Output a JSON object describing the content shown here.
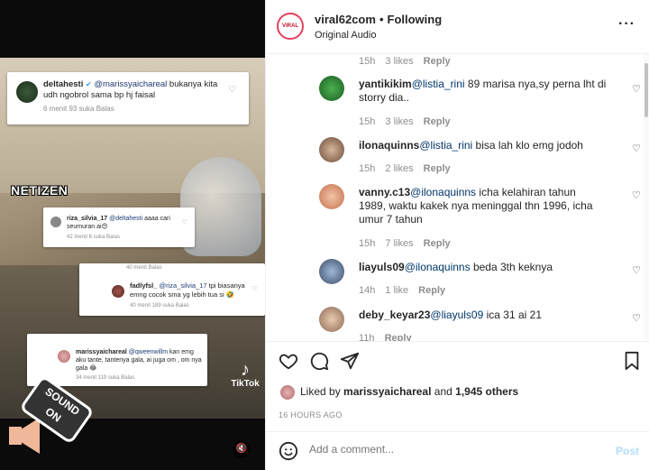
{
  "video": {
    "c1": {
      "user": "deltahesti",
      "mention": "@marissyaichareal",
      "text": " bukanya kita udh ngobrol sama bp hj faisal",
      "meta": "6 menit     93 suka     Balas"
    },
    "netizen": "NETIZEN",
    "c2": {
      "user": "riza_silvia_17",
      "mention": "@deltahesti",
      "text": " aaaa cari seumuran ai😍",
      "meta": "42 menit     6 suka     Balas"
    },
    "c3": {
      "top": "40 menit     Balas",
      "user": "fadlyfsl_",
      "mention": "@riza_silvia_17",
      "text": " tpi biasanya emng cocok sma yg lebih tua si 🤣",
      "meta": "40 menit     189 suka     Balas"
    },
    "c4": {
      "user": "marissyaichareal",
      "mention": "@qweenwillm",
      "text": " kan emg aku tante, tantenya gala, ai juga om , om nya gala 😂",
      "meta": "34 menit     119 suka     Balas"
    },
    "tiktok": "TikTok",
    "sound_badge": "SOUND ON",
    "mute_icon": "🔇"
  },
  "header": {
    "logo_text": "VIRAL",
    "username": "viral62com",
    "dot": "•",
    "follow": "Following",
    "audio": "Original Audio",
    "more": "···"
  },
  "comments": [
    {
      "meta_top": {
        "time": "15h",
        "likes": "3 likes",
        "reply": "Reply"
      }
    },
    {
      "user": "yantikikim",
      "mention": "@listia_rini",
      "text": " 89 marisa nya,sy perna lht di storry dia..",
      "time": "15h",
      "likes": "3 likes",
      "reply": "Reply"
    },
    {
      "user": "ilonaquinns",
      "mention": "@listia_rini",
      "text": " bisa lah klo emg jodoh",
      "time": "15h",
      "likes": "2 likes",
      "reply": "Reply"
    },
    {
      "user": "vanny.c13",
      "mention": "@ilonaquinns",
      "text": " icha kelahiran tahun 1989, waktu kakek nya meninggal thn 1996, icha umur 7 tahun",
      "time": "15h",
      "likes": "7 likes",
      "reply": "Reply"
    },
    {
      "user": "liayuls09",
      "mention": "@ilonaquinns",
      "text": " beda 3th keknya",
      "time": "14h",
      "likes": "1 like",
      "reply": "Reply"
    },
    {
      "user": "deby_keyar23",
      "mention": "@liayuls09",
      "text": " ica 31 ai 21",
      "time": "11h",
      "likes": "",
      "reply": "Reply"
    }
  ],
  "actions": {
    "liked_prefix": "Liked by ",
    "liked_user": "marissyaichareal",
    "liked_and": " and ",
    "liked_others": "1,945 others",
    "time": "16 HOURS AGO"
  },
  "addbar": {
    "placeholder": "Add a comment...",
    "post": "Post"
  }
}
